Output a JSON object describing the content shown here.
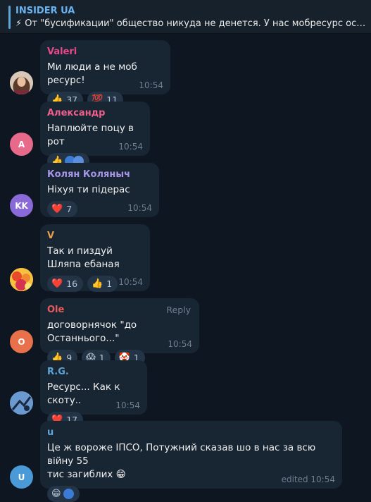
{
  "pinned": {
    "title": "INSIDER UA",
    "icon": "⚡",
    "text": "От \"бусификации\" общество никуда не денется. У нас мобресурс остался т..."
  },
  "messages": [
    {
      "author": "Valeri",
      "author_color": "#e84a8a",
      "text": [
        "Ми люди а не моб ресурс!"
      ],
      "time": "10:54",
      "reactions": [
        {
          "emoji": "👍",
          "count": "37"
        },
        {
          "emoji": "💯",
          "count": "11"
        }
      ]
    },
    {
      "author": "Александр",
      "author_color": "#ef5f8a",
      "text": [
        "Наплюйте поцу в рот"
      ],
      "time": "10:54",
      "avatar_letter": "A",
      "reactions": [
        {
          "emoji": "👍",
          "count": ""
        }
      ]
    },
    {
      "author": "Колян Коляныч",
      "author_color": "#a695e7",
      "text": [
        "Ніхуя ти підерас"
      ],
      "time": "10:54",
      "avatar_letter": "KK",
      "reactions": [
        {
          "emoji": "❤️",
          "count": "7"
        }
      ]
    },
    {
      "author": "V",
      "author_color": "#e8a04a",
      "text": [
        "Так и пиздуй",
        "Шляпа ебаная"
      ],
      "time": "10:54",
      "reactions": [
        {
          "emoji": "❤️",
          "count": "16"
        },
        {
          "emoji": "👍",
          "count": "1"
        }
      ]
    },
    {
      "author": "Ole",
      "author_color": "#e65c5c",
      "reply": "Reply",
      "text": [
        "договорнячок \"до Останнього...\""
      ],
      "time": "10:54",
      "avatar_letter": "O",
      "reactions": [
        {
          "emoji": "👍",
          "count": "9"
        },
        {
          "emoji": "😱",
          "count": "1"
        },
        {
          "emoji": "🤡",
          "count": "1"
        }
      ]
    },
    {
      "author": "R.G.",
      "author_color": "#5ea5d8",
      "text": [
        "Ресурс... Как к скоту.."
      ],
      "time": "10:54",
      "reactions": [
        {
          "emoji": "❤️",
          "count": "17"
        }
      ]
    },
    {
      "author": "u",
      "author_color": "#5ea5d8",
      "text": [
        "Це ж вороже ІПСО, Потужний сказав шо в нас за всю війну 55",
        "тис загиблих 😁"
      ],
      "time": "edited 10:54",
      "avatar_letter": "U",
      "reactions": [
        {
          "emoji": "😁",
          "count": ""
        }
      ]
    }
  ]
}
